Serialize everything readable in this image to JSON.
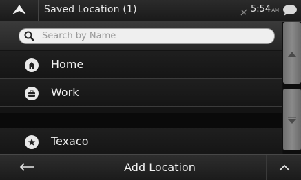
{
  "header": {
    "title": "Saved Location (1)",
    "time": "5:54",
    "ampm": "AM",
    "nav_icon": "navigation-arrow-icon",
    "gps_icon": "gps-off-icon",
    "message_icon": "chat-bubble-icon"
  },
  "search": {
    "placeholder": "Search by Name",
    "icon": "search-icon"
  },
  "items": [
    {
      "label": "Home",
      "icon": "home-icon"
    },
    {
      "label": "Work",
      "icon": "briefcase-icon"
    },
    {
      "label": "Texaco",
      "icon": "star-icon"
    }
  ],
  "scrollbar": {
    "up_icon": "triangle-up-icon",
    "down_icon": "triangle-down-icon"
  },
  "footer": {
    "back_icon": "arrow-left-icon",
    "add_label": "Add Location",
    "up_icon": "chevron-up-icon"
  },
  "colors": {
    "background": "#111111",
    "text": "#f0f0f0",
    "search_field": "#efefef",
    "scroll_button": "#7c7c7c"
  }
}
